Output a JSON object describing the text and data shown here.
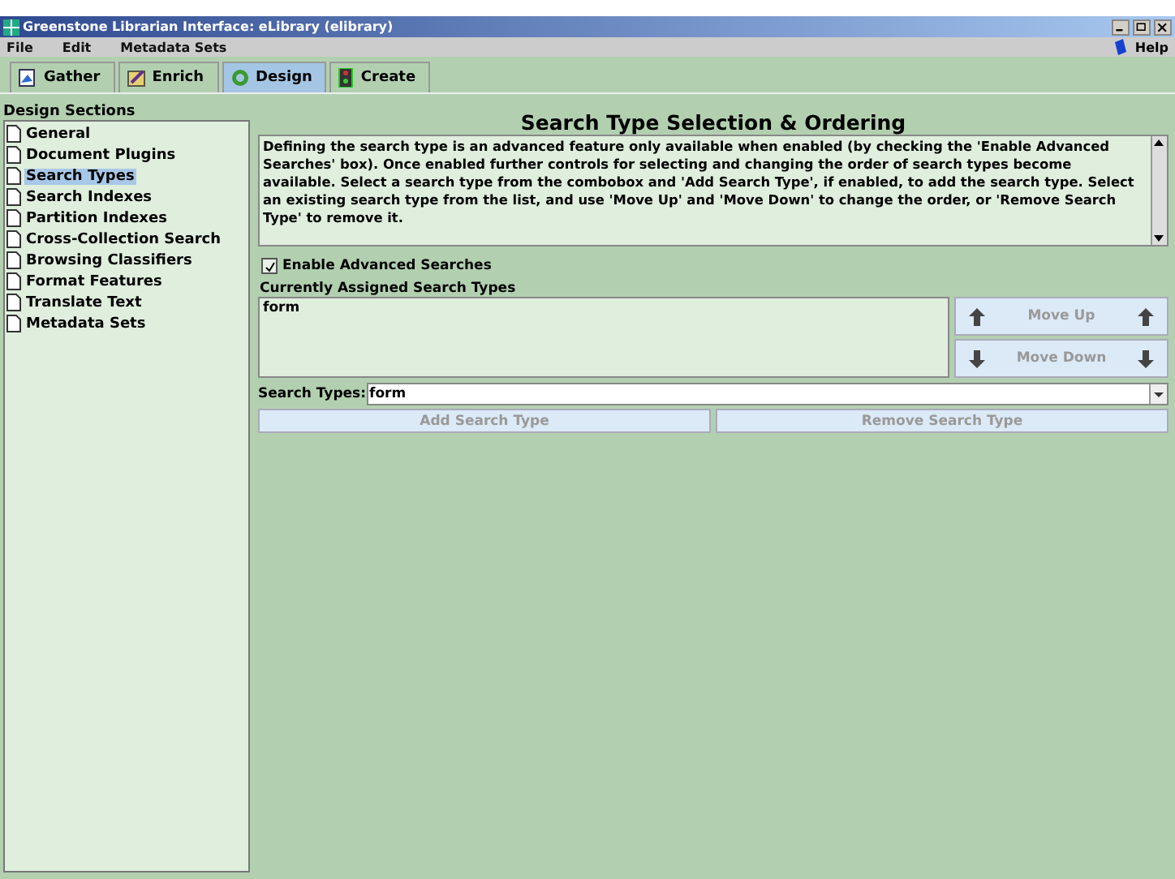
{
  "window": {
    "title": "Greenstone Librarian Interface: eLibrary (elibrary)"
  },
  "menu": [
    {
      "label": "File"
    },
    {
      "label": "Edit"
    },
    {
      "label": "Metadata Sets"
    }
  ],
  "help": {
    "label": "Help"
  },
  "tabs": [
    {
      "label": "Gather",
      "kind": "gather",
      "selected": false
    },
    {
      "label": "Enrich",
      "kind": "enrich",
      "selected": false
    },
    {
      "label": "Design",
      "kind": "design",
      "selected": true
    },
    {
      "label": "Create",
      "kind": "create",
      "selected": false
    }
  ],
  "sidebar": {
    "title": "Design Sections",
    "items": [
      {
        "label": "General",
        "selected": false
      },
      {
        "label": "Document Plugins",
        "selected": false
      },
      {
        "label": "Search Types",
        "selected": true
      },
      {
        "label": "Search Indexes",
        "selected": false
      },
      {
        "label": "Partition Indexes",
        "selected": false
      },
      {
        "label": "Cross-Collection Search",
        "selected": false
      },
      {
        "label": "Browsing Classifiers",
        "selected": false
      },
      {
        "label": "Format Features",
        "selected": false
      },
      {
        "label": "Translate Text",
        "selected": false
      },
      {
        "label": "Metadata Sets",
        "selected": false
      }
    ]
  },
  "content": {
    "title": "Search Type Selection & Ordering",
    "description": "Defining the search type is an advanced feature only available when enabled (by checking the 'Enable Advanced Searches' box). Once enabled further controls for selecting and changing the order of search types become available. Select a search type from the combobox and 'Add Search Type', if enabled, to add the search type. Select an existing search type from the list, and use 'Move Up' and 'Move Down' to change the order, or 'Remove Search Type' to remove it.",
    "enable_advanced": {
      "label": "Enable Advanced Searches",
      "checked": true
    },
    "assigned_label": "Currently Assigned Search Types",
    "assigned": [
      "form"
    ],
    "move_buttons": [
      {
        "label": "Move Up",
        "kind": "up",
        "disabled": true
      },
      {
        "label": "Move Down",
        "kind": "down",
        "disabled": true
      }
    ],
    "search_types": {
      "label": "Search Types:",
      "value": "form"
    },
    "action_buttons": [
      {
        "label": "Add Search Type",
        "disabled": true
      },
      {
        "label": "Remove Search Type",
        "disabled": true
      }
    ]
  }
}
